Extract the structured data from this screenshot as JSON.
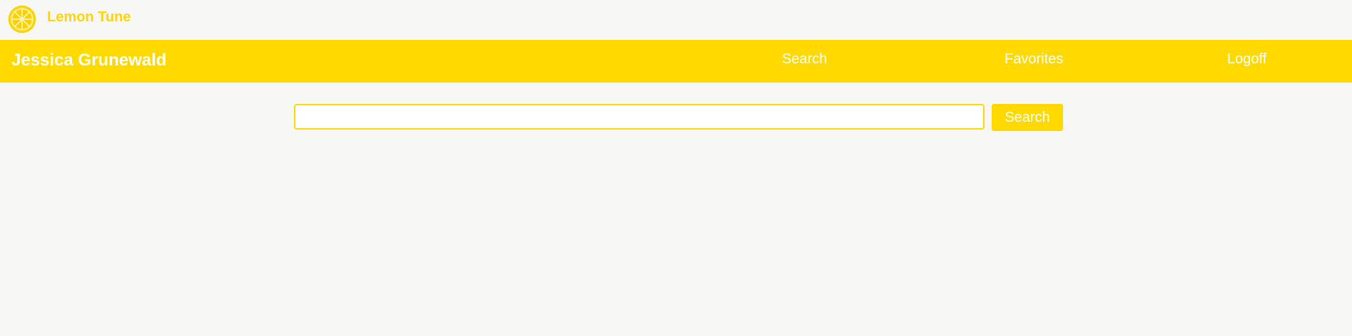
{
  "app": {
    "title": "Lemon Tune",
    "logo_icon": "lemon-slice-icon",
    "accent_color": "#ffd900"
  },
  "navbar": {
    "user_name": "Jessica Grunewald",
    "links": [
      {
        "label": "Search"
      },
      {
        "label": "Favorites"
      },
      {
        "label": "Logoff"
      }
    ]
  },
  "search": {
    "value": "",
    "placeholder": "",
    "button_label": "Search"
  }
}
